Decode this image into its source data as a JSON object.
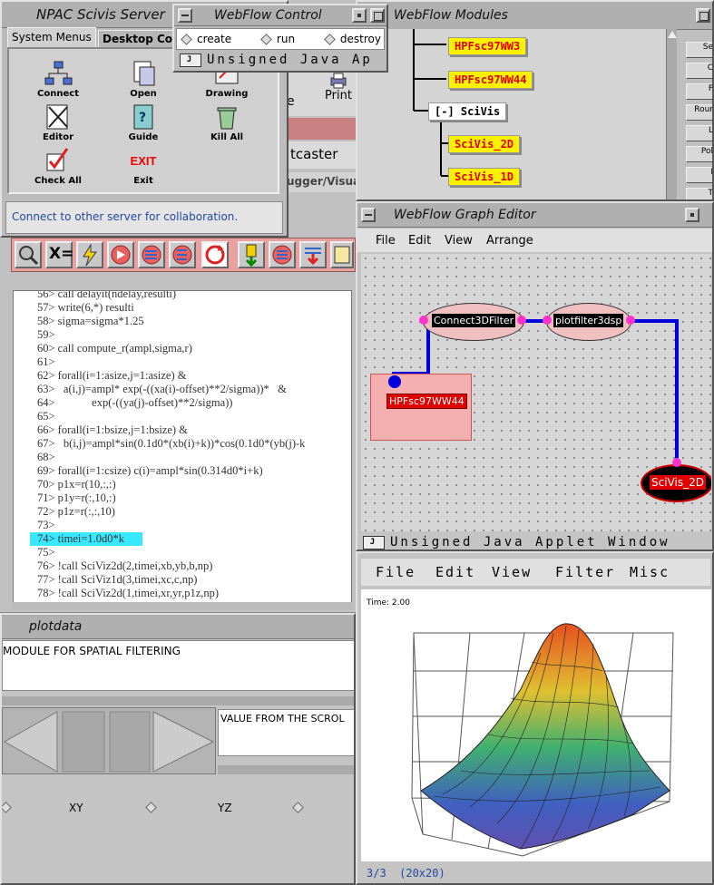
{
  "scivis_server": {
    "title": "NPAC Scivis Server",
    "tabs": [
      "System Menus",
      "Desktop Cont"
    ],
    "icons": [
      {
        "label": "Connect",
        "icon": "network-icon"
      },
      {
        "label": "Open",
        "icon": "open-folder-icon"
      },
      {
        "label": "Drawing",
        "icon": "drawing-icon"
      },
      {
        "label": "Editor",
        "icon": "editor-icon"
      },
      {
        "label": "Guide",
        "icon": "guide-icon"
      },
      {
        "label": "Kill All",
        "icon": "trash-icon"
      },
      {
        "label": "Check All",
        "icon": "check-icon"
      },
      {
        "label": "Exit",
        "icon": "exit-icon"
      }
    ],
    "exit_sign": "EXIT",
    "status": "Connect to other server for collaboration."
  },
  "webflow_control": {
    "title": "WebFlow Control",
    "options": [
      "create",
      "run",
      "destroy"
    ],
    "applet_label": "Unsigned Java Ap"
  },
  "webflow_modules": {
    "title": "WebFlow Modules",
    "modules": [
      "HPFsc97WW3",
      "HPFsc97WW44"
    ],
    "group": "[-] SciVis",
    "children": [
      "SciVis_2D",
      "SciVis_1D"
    ],
    "side_buttons": [
      "Se",
      "C",
      "F",
      "Rour",
      "L",
      "Pol",
      "I",
      "T"
    ]
  },
  "background_app": {
    "print_label": "Print",
    "e_label": "e",
    "caster_label": "tcaster",
    "debugger_label": "ugger/Visual"
  },
  "toolbar": {
    "x_label": "X="
  },
  "code": {
    "lines": [
      "56> call delayit(ndelay,resulti)",
      "57> write(6,*) resulti",
      "58> sigma=sigma*1.25",
      "59>",
      "60> call compute_r(ampl,sigma,r)",
      "61>",
      "62> forall(i=1:asize,j=1:asize) &",
      "63>   a(i,j)=ampl* exp(-((xa(i)-offset)**2/sigma))*   &",
      "64>             exp(-((ya(j)-offset)**2/sigma))",
      "65>",
      "66> forall(i=1:bsize,j=1:bsize) &",
      "67>   b(i,j)=ampl*sin(0.1d0*(xb(i)+k))*cos(0.1d0*(yb(j)-k",
      "68>",
      "69> forall(i=1:csize) c(i)=ampl*sin(0.314d0*i+k)",
      "70> p1x=r(10,:,:)",
      "71> p1y=r(:,10,:)",
      "72> p1z=r(:,:,10)",
      "73>",
      "74> timei=1.0d0*k",
      "75>",
      "76> !call SciViz2d(2,timei,xb,yb,b,np)",
      "77> !call SciViz1d(3,timei,xc,c,np)",
      "78> !call SciViz2d(1,timei,xr,yr,p1z,np)"
    ],
    "highlight_index": 18,
    "highlight_color": "#38e8ff"
  },
  "plotdata": {
    "title": "plotdata",
    "module_text": "MODULE FOR SPATIAL FILTERING",
    "scroll_text": "VALUE FROM THE SCROL",
    "axes": [
      "XY",
      "YZ"
    ]
  },
  "graph_editor": {
    "title": "WebFlow Graph Editor",
    "menu": [
      "File",
      "Edit",
      "View",
      "Arrange"
    ],
    "nodes": [
      "Connect3DFilter",
      "plotfilter3dsp",
      "HPFsc97WW44",
      "SciVis_2D"
    ],
    "applet_label": "Unsigned Java Applet Window"
  },
  "plot_viewer": {
    "menu": [
      "File",
      "Edit",
      "View",
      "Filter",
      "Misc"
    ],
    "time": "Time: 2.00",
    "status": "3/3  (20x20)"
  },
  "colors": {
    "module_fill": "#fff200",
    "module_text": "#e00000",
    "wire": "#0000dd",
    "port": "#ff33cc"
  }
}
